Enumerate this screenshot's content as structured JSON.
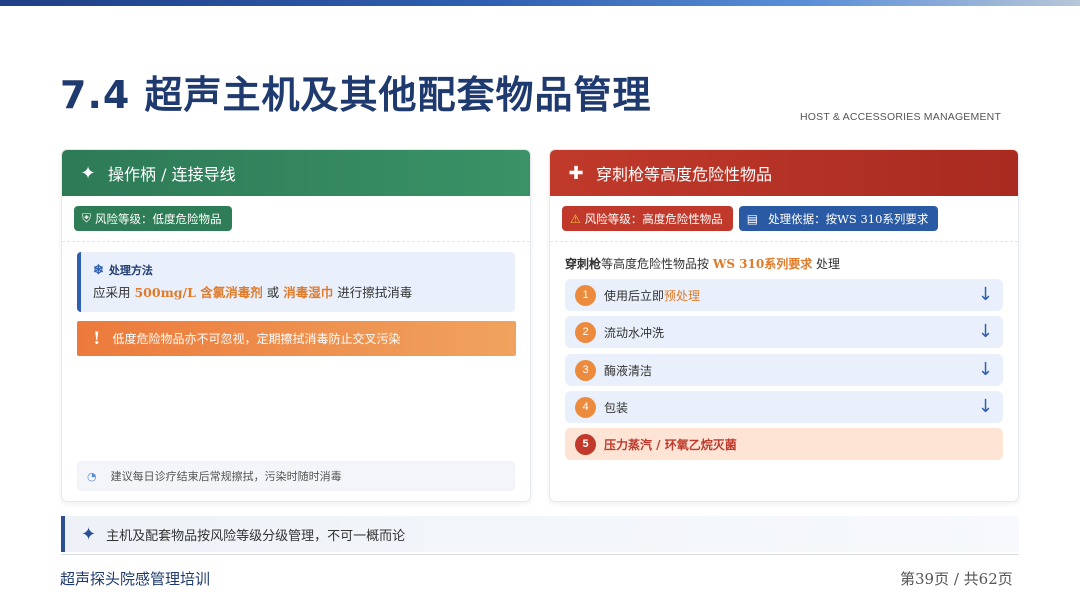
{
  "slide": {
    "title": "7.4 超声主机及其他配套物品管理",
    "subtitle": "HOST & ACCESSORIES MANAGEMENT"
  },
  "left_card": {
    "header": "操作柄 / 连接导线",
    "header_icon": "sparkle-icon",
    "badge": "风险等级：低度危险物品",
    "method_label": "处理方法",
    "method_parts": {
      "p1": "应采用 ",
      "h1": "500mg/L 含氯消毒剂",
      "p2": " 或 ",
      "h2": "消毒湿巾",
      "p3": " 进行擦拭消毒"
    },
    "warning": "低度危险物品亦不可忽视，定期擦拭消毒防止交叉污染",
    "tip": "建议每日诊疗结束后常规擦拭，污染时随时消毒"
  },
  "right_card": {
    "header": "穿刺枪等高度危险性物品",
    "header_icon": "plus-cross-icon",
    "badge_risk": "风险等级：高度危险性物品",
    "badge_basis": "处理依据：按WS 310系列要求",
    "intro": {
      "strong": "穿刺枪",
      "p1": "等高度危险性物品按 ",
      "h1": "WS 310系列要求",
      "p2": " 处理"
    },
    "steps": [
      {
        "num": "1",
        "pre": "使用后立即",
        "accent": "预处理"
      },
      {
        "num": "2",
        "pre": "流动水冲洗",
        "accent": ""
      },
      {
        "num": "3",
        "pre": "酶液清洁",
        "accent": ""
      },
      {
        "num": "4",
        "pre": "包装",
        "accent": ""
      },
      {
        "num": "5",
        "pre": "压力蒸汽 / 环氧乙烷灭菌",
        "accent": ""
      }
    ],
    "arrow_glyph": "↓"
  },
  "bottom_note": "主机及配套物品按风险等级分级管理，不可一概而论",
  "footer": {
    "left": "超声探头院感管理培训",
    "right": "第39页 / 共62页"
  },
  "colors": {
    "title": "#1f3a6e",
    "green": "#2f7d56",
    "red": "#c0392b",
    "blue": "#2b5aa4",
    "orange": "#e07b2c"
  }
}
